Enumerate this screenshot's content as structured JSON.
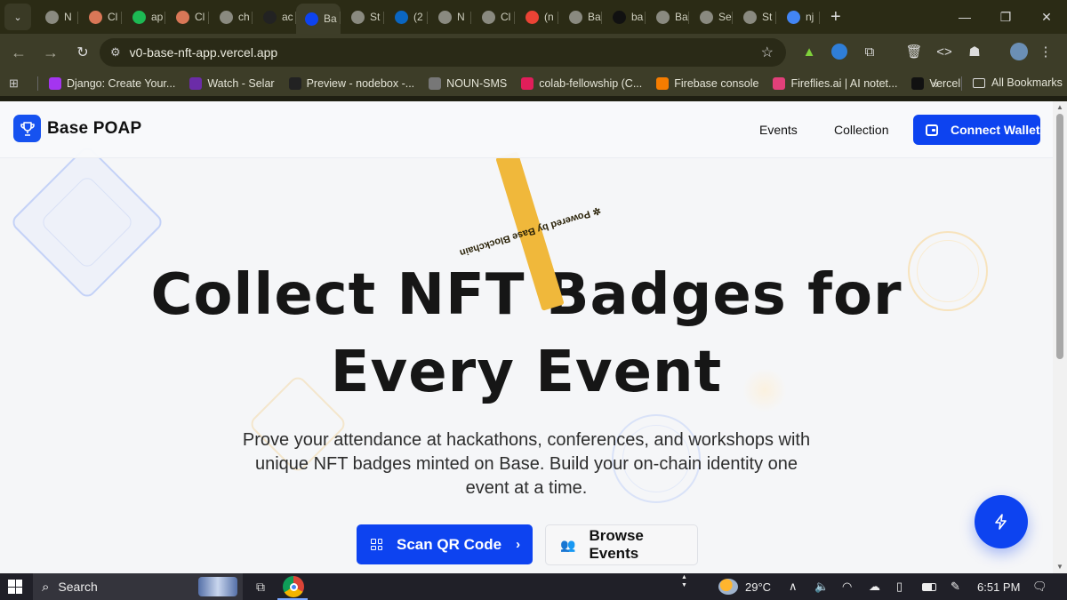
{
  "browser": {
    "tabs": [
      {
        "label": "N",
        "icon": "chrome-icon",
        "color": "#8a8a80"
      },
      {
        "label": "Cl",
        "icon": "claude-icon",
        "color": "#d97757"
      },
      {
        "label": "ap",
        "icon": "app-icon",
        "color": "#1db954"
      },
      {
        "label": "Cl",
        "icon": "claude-icon",
        "color": "#d97757"
      },
      {
        "label": "ch",
        "icon": "globe-icon",
        "color": "#8a8a80"
      },
      {
        "label": "ac",
        "icon": "github-icon",
        "color": "#222222"
      },
      {
        "label": "Ba",
        "icon": "base-icon",
        "color": "#0d43f0",
        "active": true
      },
      {
        "label": "St",
        "icon": "globe-icon",
        "color": "#8a8a80"
      },
      {
        "label": "(2",
        "icon": "linkedin-icon",
        "color": "#0a66c2"
      },
      {
        "label": "N",
        "icon": "openai-icon",
        "color": "#8a8a80"
      },
      {
        "label": "Cl",
        "icon": "openai-icon",
        "color": "#8a8a80"
      },
      {
        "label": "(n",
        "icon": "gmail-icon",
        "color": "#ea4335"
      },
      {
        "label": "Ba",
        "icon": "globe-icon",
        "color": "#8a8a80"
      },
      {
        "label": "ba",
        "icon": "vercel-icon",
        "color": "#111111"
      },
      {
        "label": "Ba",
        "icon": "globe-icon",
        "color": "#8a8a80"
      },
      {
        "label": "Se",
        "icon": "gear-icon",
        "color": "#8a8a80"
      },
      {
        "label": "St",
        "icon": "globe-icon",
        "color": "#8a8a80"
      },
      {
        "label": "nj",
        "icon": "google-icon",
        "color": "#4285f4"
      }
    ],
    "url": "v0-base-nft-app.vercel.app",
    "bookmarks": [
      {
        "label": "Django: Create Your...",
        "icon": "udemy-icon",
        "color": "#a435f0"
      },
      {
        "label": "Watch - Selar",
        "icon": "selar-icon",
        "color": "#6b2ca8"
      },
      {
        "label": "Preview - nodebox -...",
        "icon": "nodebox-icon",
        "color": "#222222"
      },
      {
        "label": "NOUN-SMS",
        "icon": "globe-icon",
        "color": "#777777"
      },
      {
        "label": "colab-fellowship (C...",
        "icon": "slack-icon",
        "color": "#e01e5a"
      },
      {
        "label": "Firebase console",
        "icon": "firebase-icon",
        "color": "#f57c00"
      },
      {
        "label": "Fireflies.ai | AI notet...",
        "icon": "fireflies-icon",
        "color": "#e2407a"
      },
      {
        "label": "Vercel",
        "icon": "vercel-icon",
        "color": "#111111"
      }
    ],
    "all_bookmarks": "All Bookmarks",
    "overflow": "»"
  },
  "site": {
    "brand": "Base POAP",
    "nav": {
      "events": "Events",
      "collection": "Collection"
    },
    "connect_wallet": "Connect Wallet",
    "ribbon": "Powered by Base Blockchain",
    "headline_line1": "Collect NFT Badges for",
    "headline_line2": "Every Event",
    "subtitle": "Prove your attendance at hackathons, conferences, and workshops with unique NFT badges minted on Base. Build your on-chain identity one event at a time.",
    "scan_qr": "Scan QR Code",
    "browse_events": "Browse Events",
    "colors": {
      "primary": "#0d43f0",
      "ribbon": "#f0b83b",
      "text": "#161616"
    }
  },
  "taskbar": {
    "search": "Search",
    "temperature": "29°C",
    "time": "6:51 PM"
  }
}
